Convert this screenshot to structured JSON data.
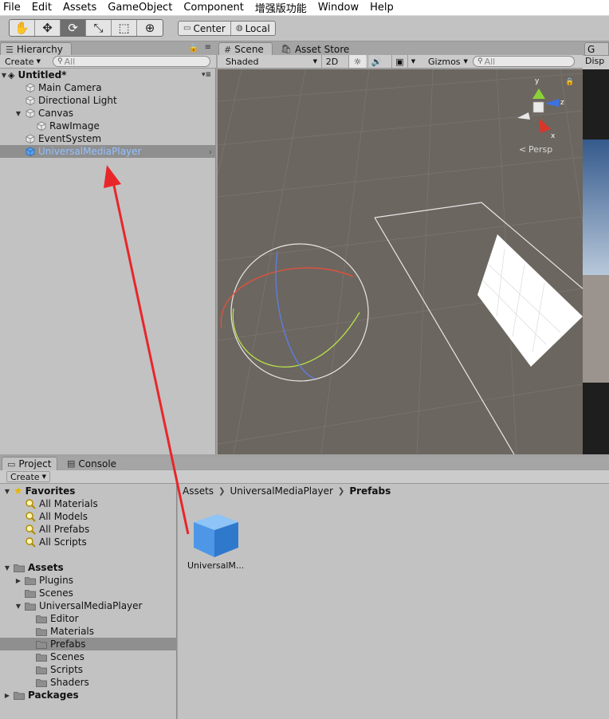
{
  "menu": [
    "File",
    "Edit",
    "Assets",
    "GameObject",
    "Component",
    "增强版功能",
    "Window",
    "Help"
  ],
  "toolbar": {
    "tools": [
      {
        "name": "hand-tool",
        "glyph": "✋"
      },
      {
        "name": "move-tool",
        "glyph": "✥"
      },
      {
        "name": "rotate-tool",
        "glyph": "⟳"
      },
      {
        "name": "scale-tool",
        "glyph": "⤡"
      },
      {
        "name": "rect-tool",
        "glyph": "⬚"
      },
      {
        "name": "transform-tool",
        "glyph": "⊕"
      }
    ],
    "pivot_label": "Center",
    "space_label": "Local"
  },
  "hierarchy": {
    "tab_label": "Hierarchy",
    "create_label": "Create",
    "search_placeholder": "All",
    "scene_name": "Untitled*",
    "items": [
      {
        "label": "Main Camera"
      },
      {
        "label": "Directional Light"
      },
      {
        "label": "Canvas"
      },
      {
        "label": "RawImage"
      },
      {
        "label": "EventSystem"
      },
      {
        "label": "UniversalMediaPlayer"
      }
    ]
  },
  "scene": {
    "tab_label": "Scene",
    "store_tab_label": "Asset Store",
    "shading_label": "Shaded",
    "mode_2d_label": "2D",
    "gizmos_label": "Gizmos",
    "search_placeholder": "All",
    "persp_label": "Persp",
    "axis_y": "y",
    "axis_z": "z",
    "axis_x": "x"
  },
  "game": {
    "tab_label": "G",
    "display_label": "Disp"
  },
  "project": {
    "tab_label": "Project",
    "console_tab_label": "Console",
    "create_label": "Create",
    "favorites_label": "Favorites",
    "favorites": [
      "All Materials",
      "All Models",
      "All Prefabs",
      "All Scripts"
    ],
    "assets_label": "Assets",
    "asset_folders": {
      "plugins": "Plugins",
      "scenes": "Scenes",
      "ump": "UniversalMediaPlayer",
      "ump_children": [
        "Editor",
        "Materials",
        "Prefabs",
        "Scenes",
        "Scripts",
        "Shaders"
      ]
    },
    "packages_label": "Packages",
    "breadcrumb": [
      "Assets",
      "UniversalMediaPlayer",
      "Prefabs"
    ],
    "asset_item_label": "UniversalM..."
  },
  "colors": {
    "selection_text": "#93c1ff",
    "scene_bg": "#6c6660",
    "arrow": "#e8262a",
    "prefab_cube": "#4d97e6"
  }
}
